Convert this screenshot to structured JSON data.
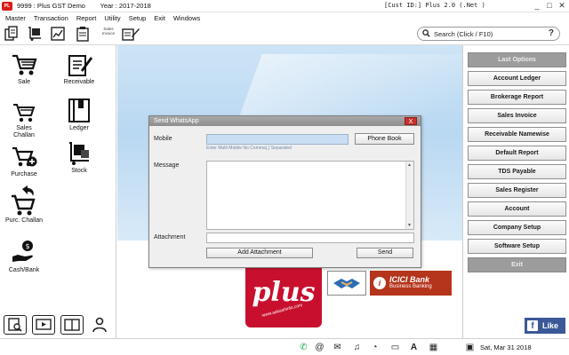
{
  "window": {
    "title": "9999 : Plus GST Demo        Year : 2017-2018",
    "customer": "[Cust ID:] Plus 2.0 (.Net )",
    "controls": [
      "_",
      "□",
      "✕"
    ]
  },
  "menu": [
    "Master",
    "Transaction",
    "Report",
    "Utility",
    "Setup",
    "Exit",
    "Windows"
  ],
  "toolbar": {
    "sales_invoice_label": "Sales Invoice",
    "search_placeholder": "Search (Click / F10)"
  },
  "sidebar": {
    "items": [
      {
        "label": "Sale",
        "icon": "cart-icon"
      },
      {
        "label": "Receivable",
        "icon": "receivable-notepad-icon"
      },
      {
        "label": "Sales Challan",
        "icon": "sales-challan-icon"
      },
      {
        "label": "Ledger",
        "icon": "ledger-book-icon"
      },
      {
        "label": "Purchase",
        "icon": "purchase-cart-icon"
      },
      {
        "label": "Stock",
        "icon": "stock-icon"
      },
      {
        "label": "Purc. Challan",
        "icon": "purchase-challan-icon"
      },
      {
        "label": "Cash/Bank",
        "icon": "cash-bank-icon"
      }
    ],
    "bottom_icons": [
      "search-doc-icon",
      "video-icon",
      "book-icon",
      "user-icon"
    ]
  },
  "dialog": {
    "title": "Send WhatsApp",
    "close": "X",
    "mobile_label": "Mobile",
    "mobile_value": "",
    "mobile_hint": "Enter Multi Mobile No Comma(,) Separated",
    "phone_book_button": "Phone Book",
    "message_label": "Message",
    "message_value": "",
    "attachment_label": "Attachment",
    "attachment_value": "",
    "add_attachment_button": "Add Attachment",
    "send_button": "Send"
  },
  "branding": {
    "plus_logo": "plus",
    "plus_url": "www.aakashinfo.com",
    "icici_title": "ICICI Bank",
    "icici_sub": "Business Banking"
  },
  "right_panel": [
    {
      "label": "Last Options",
      "style": "grey"
    },
    {
      "label": "Account Ledger",
      "style": "normal"
    },
    {
      "label": "Brokerage Report",
      "style": "normal"
    },
    {
      "label": "Sales Invoice",
      "style": "normal"
    },
    {
      "label": "Receivable Namewise",
      "style": "normal"
    },
    {
      "label": "Default Report",
      "style": "normal"
    },
    {
      "label": "TDS Payable",
      "style": "normal"
    },
    {
      "label": "Sales Register",
      "style": "normal"
    },
    {
      "label": "Account",
      "style": "normal"
    },
    {
      "label": "Company Setup",
      "style": "normal"
    },
    {
      "label": "Software Setup",
      "style": "normal"
    },
    {
      "label": "Exit",
      "style": "grey"
    }
  ],
  "facebook_like": "Like",
  "statusbar": {
    "icons": [
      "whatsapp-icon",
      "at-icon",
      "mail-icon",
      "bell-icon",
      "gauge-icon",
      "chat-icon",
      "text-a-icon",
      "grid-icon",
      "calendar-icon"
    ],
    "date": "Sat, Mar 31 2018"
  },
  "colors": {
    "accent_red": "#d71e1e",
    "fb_blue": "#3b5998",
    "mobile_field_bg": "#c9def2",
    "grey_button": "#9c9c9c"
  }
}
